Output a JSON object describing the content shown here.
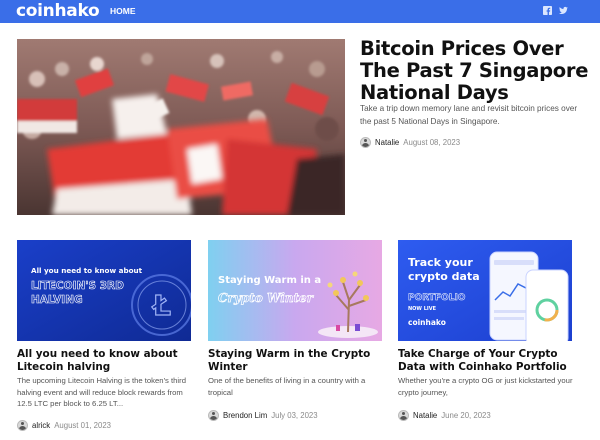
{
  "nav": {
    "logo": "coinhako",
    "home_label": "HOME",
    "social": [
      "facebook-icon",
      "twitter-icon"
    ],
    "bg_color": "#3a6ee8"
  },
  "hero": {
    "title": "Bitcoin Prices Over The Past 7 Singapore National Days",
    "summary": "Take a trip down memory lane and revisit bitcoin prices over the past 5 National Days in Singapore.",
    "author": "Natalie",
    "date": "August 08, 2023"
  },
  "cards": [
    {
      "image_heading": "All you need to know about",
      "image_big_text": "LITECOIN'S 3RD HALVING",
      "title": "All you need to know about Litecoin halving",
      "summary": "The upcoming Litecoin Halving is the token's third halving event and will reduce block rewards from 12.5 LTC per block to 6.25 LT...",
      "author": "alrick",
      "date": "August 01, 2023"
    },
    {
      "image_heading": "Staying Warm in a",
      "image_big_text": "Crypto Winter",
      "title": "Staying Warm in the Crypto Winter",
      "summary": "One of the benefits of living in a country with a tropical",
      "author": "Brendon Lim",
      "date": "July 03, 2023"
    },
    {
      "image_heading": "Track your crypto data",
      "image_big_text": "PORTFOLIO",
      "image_sub_text": "NOW LIVE",
      "image_brand": "coinhako",
      "title": "Take Charge of Your Crypto Data with Coinhako Portfolio",
      "summary": "Whether you're a crypto OG or just kickstarted your crypto journey,",
      "author": "Natalie",
      "date": "June 20, 2023"
    }
  ]
}
